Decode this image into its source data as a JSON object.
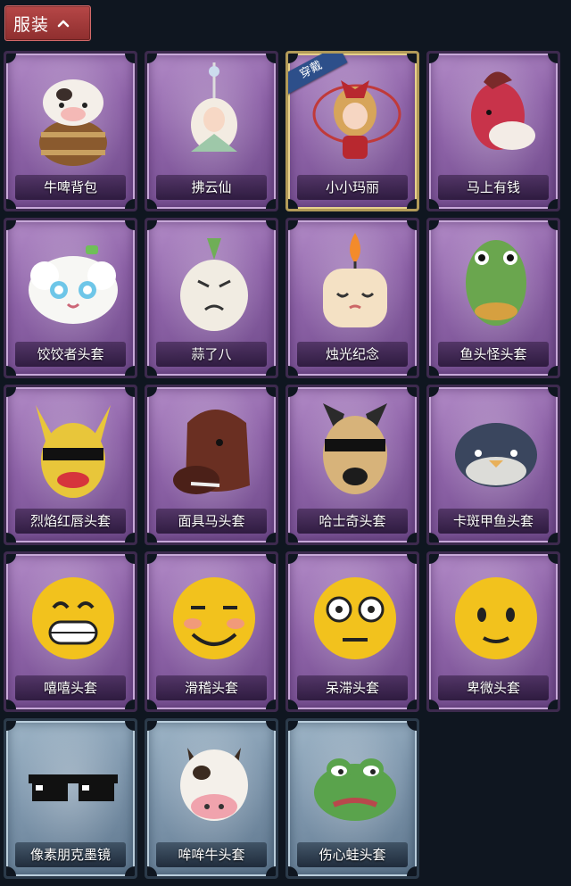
{
  "header": {
    "title": "服装",
    "chevron_icon": "chevron-up-icon",
    "color": "#b64747"
  },
  "items": [
    {
      "label": "牛啤背包",
      "icon": "cow-beer-barrel-icon",
      "frame": "purple"
    },
    {
      "label": "拂云仙",
      "icon": "fairy-pendant-icon",
      "frame": "purple"
    },
    {
      "label": "小小玛丽",
      "icon": "mary-doll-icon",
      "frame": "purple",
      "selected": true,
      "badge": "穿戴"
    },
    {
      "label": "马上有钱",
      "icon": "red-horse-icon",
      "frame": "purple"
    },
    {
      "label": "饺饺者头套",
      "icon": "dumpling-mask-icon",
      "frame": "purple"
    },
    {
      "label": "蒜了八",
      "icon": "garlic-mask-icon",
      "frame": "purple"
    },
    {
      "label": "烛光纪念",
      "icon": "candle-mask-icon",
      "frame": "purple"
    },
    {
      "label": "鱼头怪头套",
      "icon": "fish-head-mask-icon",
      "frame": "purple"
    },
    {
      "label": "烈焰红唇头套",
      "icon": "pikachu-mask-icon",
      "frame": "purple"
    },
    {
      "label": "面具马头套",
      "icon": "horse-mask-icon",
      "frame": "purple"
    },
    {
      "label": "哈士奇头套",
      "icon": "husky-mask-icon",
      "frame": "purple"
    },
    {
      "label": "卡斑甲鱼头套",
      "icon": "turtle-mask-icon",
      "frame": "purple"
    },
    {
      "label": "嘻嘻头套",
      "icon": "grin-emoji-mask-icon",
      "frame": "purple"
    },
    {
      "label": "滑稽头套",
      "icon": "smirk-emoji-mask-icon",
      "frame": "purple"
    },
    {
      "label": "呆滞头套",
      "icon": "stunned-emoji-mask-icon",
      "frame": "purple"
    },
    {
      "label": "卑微头套",
      "icon": "humble-emoji-mask-icon",
      "frame": "purple"
    },
    {
      "label": "像素朋克墨镜",
      "icon": "pixel-sunglasses-icon",
      "frame": "blue"
    },
    {
      "label": "哞哞牛头套",
      "icon": "cow-mask-icon",
      "frame": "blue"
    },
    {
      "label": "伤心蛙头套",
      "icon": "sad-frog-mask-icon",
      "frame": "blue"
    }
  ]
}
